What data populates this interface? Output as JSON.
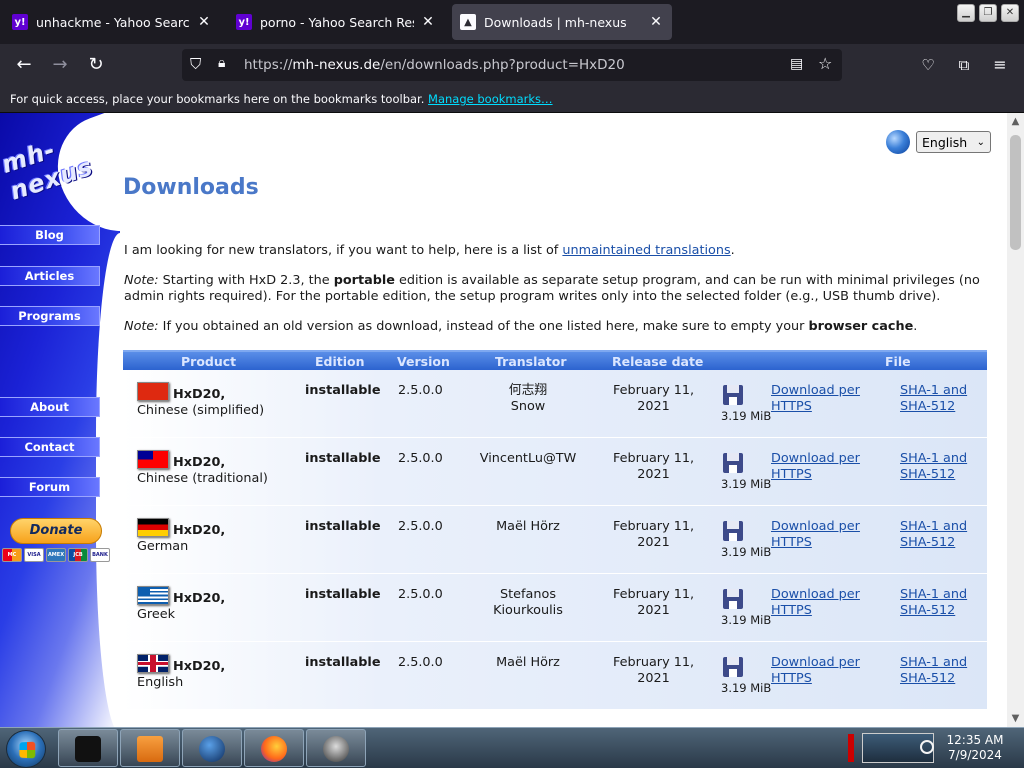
{
  "browser": {
    "tabs": [
      {
        "title": "unhackme - Yahoo Search Results",
        "favicon": "yahoo-icon"
      },
      {
        "title": "porno - Yahoo Search Results",
        "favicon": "yahoo-icon"
      },
      {
        "title": "Downloads | mh-nexus",
        "favicon": "mh-nexus-icon",
        "active": true
      }
    ],
    "url_prefix": "https://",
    "url_host": "mh-nexus.de",
    "url_path": "/en/downloads.php?product=HxD20",
    "bookmarks_text": "For quick access, place your bookmarks here on the bookmarks toolbar.",
    "bookmarks_link": "Manage bookmarks…"
  },
  "sidebar": {
    "logo": "mh-nexus",
    "menu": [
      "Blog",
      "Articles",
      "Programs",
      "About",
      "Contact",
      "Forum"
    ],
    "donate_label": "Donate",
    "cards": [
      "MC",
      "VISA",
      "AMEX",
      "JCB",
      "BANK"
    ]
  },
  "language": {
    "selected": "English"
  },
  "page": {
    "heading": "Downloads",
    "p1_text": "I am looking for new translators, if you want to help, here is a list of ",
    "p1_link": "unmaintained translations",
    "p1_end": ".",
    "p2_note": "Note:",
    "p2_a": " Starting with HxD 2.3, the ",
    "p2_bold": "portable",
    "p2_b": " edition is available as separate setup program, and can be run with minimal privileges (no admin rights required). For the portable edition, the setup program writes only into the selected folder (e.g., USB thumb drive).",
    "p3_note": "Note:",
    "p3_a": " If you obtained an old version as download, instead of the one listed here, make sure to empty your ",
    "p3_bold": "browser cache",
    "p3_end": "."
  },
  "table": {
    "headers": [
      "Product",
      "Edition",
      "Version",
      "Translator",
      "Release date",
      "File signatures"
    ],
    "rows": [
      {
        "product": "HxD20,",
        "language": "Chinese (simplified)",
        "edition": "installable",
        "version": "2.5.0.0",
        "translator1": "何志翔",
        "translator2": "Snow",
        "date1": "February 11,",
        "date2": "2021",
        "size": "3.19 MiB",
        "dl1": "Download per",
        "dl2": "HTTPS",
        "sig1": "SHA-1 and",
        "sig2": "SHA-512",
        "flag": "china"
      },
      {
        "product": "HxD20,",
        "language": "Chinese (traditional)",
        "edition": "installable",
        "version": "2.5.0.0",
        "translator1": "VincentLu@TW",
        "translator2": "",
        "date1": "February 11,",
        "date2": "2021",
        "size": "3.19 MiB",
        "dl1": "Download per",
        "dl2": "HTTPS",
        "sig1": "SHA-1 and",
        "sig2": "SHA-512",
        "flag": "taiwan"
      },
      {
        "product": "HxD20,",
        "language": "German",
        "edition": "installable",
        "version": "2.5.0.0",
        "translator1": "Maël Hörz",
        "translator2": "",
        "date1": "February 11,",
        "date2": "2021",
        "size": "3.19 MiB",
        "dl1": "Download per",
        "dl2": "HTTPS",
        "sig1": "SHA-1 and",
        "sig2": "SHA-512",
        "flag": "germany"
      },
      {
        "product": "HxD20,",
        "language": "Greek",
        "edition": "installable",
        "version": "2.5.0.0",
        "translator1": "Stefanos",
        "translator2": "Kiourkoulis",
        "date1": "February 11,",
        "date2": "2021",
        "size": "3.19 MiB",
        "dl1": "Download per",
        "dl2": "HTTPS",
        "sig1": "SHA-1 and",
        "sig2": "SHA-512",
        "flag": "greece"
      },
      {
        "product": "HxD20,",
        "language": "English",
        "edition": "installable",
        "version": "2.5.0.0",
        "translator1": "Maël Hörz",
        "translator2": "",
        "date1": "February 11,",
        "date2": "2021",
        "size": "3.19 MiB",
        "dl1": "Download per",
        "dl2": "HTTPS",
        "sig1": "SHA-1 and",
        "sig2": "SHA-512",
        "flag": "uk"
      }
    ]
  },
  "taskbar": {
    "time": "12:35 AM",
    "date": "7/9/2024"
  }
}
